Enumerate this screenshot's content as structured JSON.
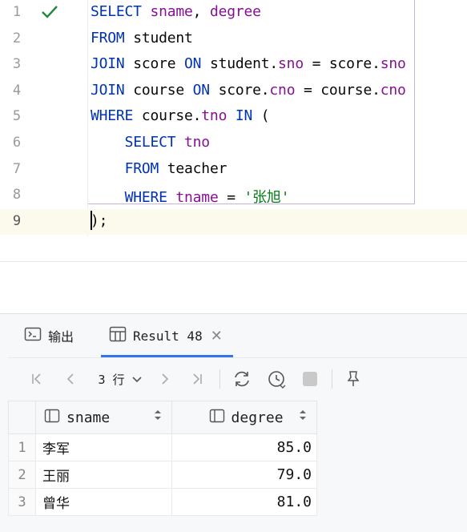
{
  "editor": {
    "lines": [
      {
        "num": "1",
        "tokens": [
          {
            "t": "SELECT",
            "c": "kw"
          },
          {
            "t": " ",
            "c": ""
          },
          {
            "t": "sname",
            "c": "id"
          },
          {
            "t": ", ",
            "c": ""
          },
          {
            "t": "degree",
            "c": "id"
          }
        ]
      },
      {
        "num": "2",
        "tokens": [
          {
            "t": "FROM",
            "c": "kw"
          },
          {
            "t": " student",
            "c": ""
          }
        ]
      },
      {
        "num": "3",
        "tokens": [
          {
            "t": "JOIN",
            "c": "kw"
          },
          {
            "t": " score ",
            "c": ""
          },
          {
            "t": "ON",
            "c": "kw"
          },
          {
            "t": " student.",
            "c": ""
          },
          {
            "t": "sno",
            "c": "id"
          },
          {
            "t": " = score.",
            "c": ""
          },
          {
            "t": "sno",
            "c": "id"
          }
        ]
      },
      {
        "num": "4",
        "tokens": [
          {
            "t": "JOIN",
            "c": "kw"
          },
          {
            "t": " course ",
            "c": ""
          },
          {
            "t": "ON",
            "c": "kw"
          },
          {
            "t": " score.",
            "c": ""
          },
          {
            "t": "cno",
            "c": "id"
          },
          {
            "t": " = course.",
            "c": ""
          },
          {
            "t": "cno",
            "c": "id"
          }
        ]
      },
      {
        "num": "5",
        "tokens": [
          {
            "t": "WHERE",
            "c": "kw"
          },
          {
            "t": " course.",
            "c": ""
          },
          {
            "t": "tno",
            "c": "id"
          },
          {
            "t": " ",
            "c": ""
          },
          {
            "t": "IN",
            "c": "kw"
          },
          {
            "t": " (",
            "c": ""
          }
        ]
      },
      {
        "num": "6",
        "tokens": [
          {
            "t": "    ",
            "c": ""
          },
          {
            "t": "SELECT",
            "c": "kw"
          },
          {
            "t": " ",
            "c": ""
          },
          {
            "t": "tno",
            "c": "id"
          }
        ]
      },
      {
        "num": "7",
        "tokens": [
          {
            "t": "    ",
            "c": ""
          },
          {
            "t": "FROM",
            "c": "kw"
          },
          {
            "t": " teacher",
            "c": ""
          }
        ]
      },
      {
        "num": "8",
        "tokens": [
          {
            "t": "    ",
            "c": ""
          },
          {
            "t": "WHERE",
            "c": "kw"
          },
          {
            "t": " ",
            "c": ""
          },
          {
            "t": "tname",
            "c": "id"
          },
          {
            "t": " = ",
            "c": ""
          },
          {
            "t": "'张旭'",
            "c": "str"
          }
        ]
      },
      {
        "num": "9",
        "tokens": [
          {
            "t": ");",
            "c": ""
          }
        ]
      }
    ],
    "current_line": 9
  },
  "panel": {
    "tabs": [
      {
        "label": "输出",
        "icon": "console-icon"
      },
      {
        "label": "Result 48",
        "icon": "table-grid-icon"
      }
    ],
    "toolbar": {
      "rows_label": "3 行"
    }
  },
  "result": {
    "columns": [
      "sname",
      "degree"
    ],
    "rows": [
      {
        "num": "1",
        "sname": "李军",
        "degree": "85.0"
      },
      {
        "num": "2",
        "sname": "王丽",
        "degree": "79.0"
      },
      {
        "num": "3",
        "sname": "曾华",
        "degree": "81.0"
      }
    ]
  },
  "colors": {
    "keyword": "#0033b3",
    "identifier": "#871094",
    "string": "#067d17",
    "success_check": "#208a3c",
    "active_tab_underline": "#3574f0"
  }
}
